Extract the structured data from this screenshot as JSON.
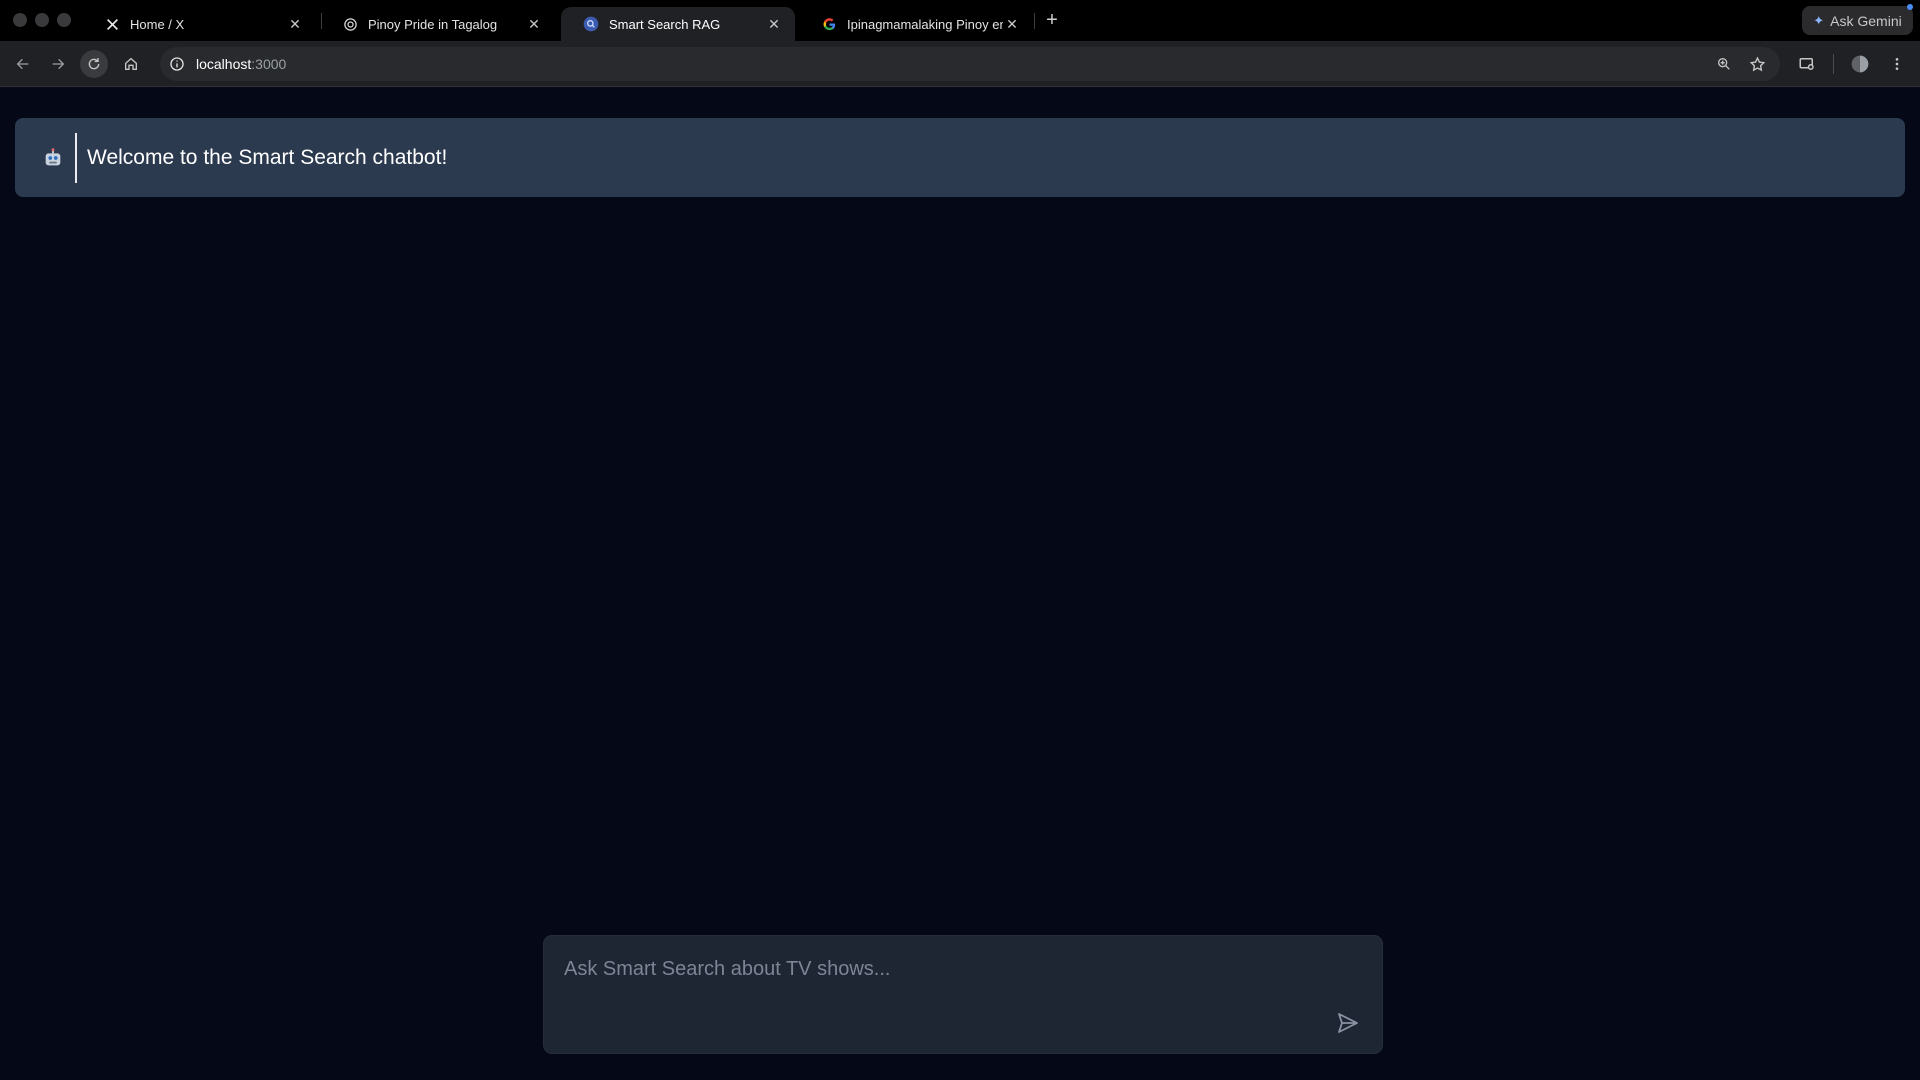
{
  "window": {
    "tabs": [
      {
        "title": "Home / X",
        "icon": "x-logo-icon",
        "active": false
      },
      {
        "title": "Pinoy Pride in Tagalog",
        "icon": "chatgpt-icon",
        "active": false
      },
      {
        "title": "Smart Search RAG",
        "icon": "smart-search-favicon",
        "active": true
      },
      {
        "title": "Ipinagmamalaking Pinoy engl",
        "icon": "google-icon",
        "active": false
      }
    ],
    "gemini_label": "Ask Gemini"
  },
  "toolbar": {
    "url_host": "localhost",
    "url_port": ":3000"
  },
  "chat": {
    "welcome_message": "Welcome to the Smart Search chatbot!",
    "bot_icon": "robot-icon"
  },
  "composer": {
    "placeholder": "Ask Smart Search about TV shows...",
    "value": ""
  },
  "colors": {
    "page_bg": "#040817",
    "welcome_bg": "#2c3a4f",
    "composer_bg": "#1e2533"
  }
}
